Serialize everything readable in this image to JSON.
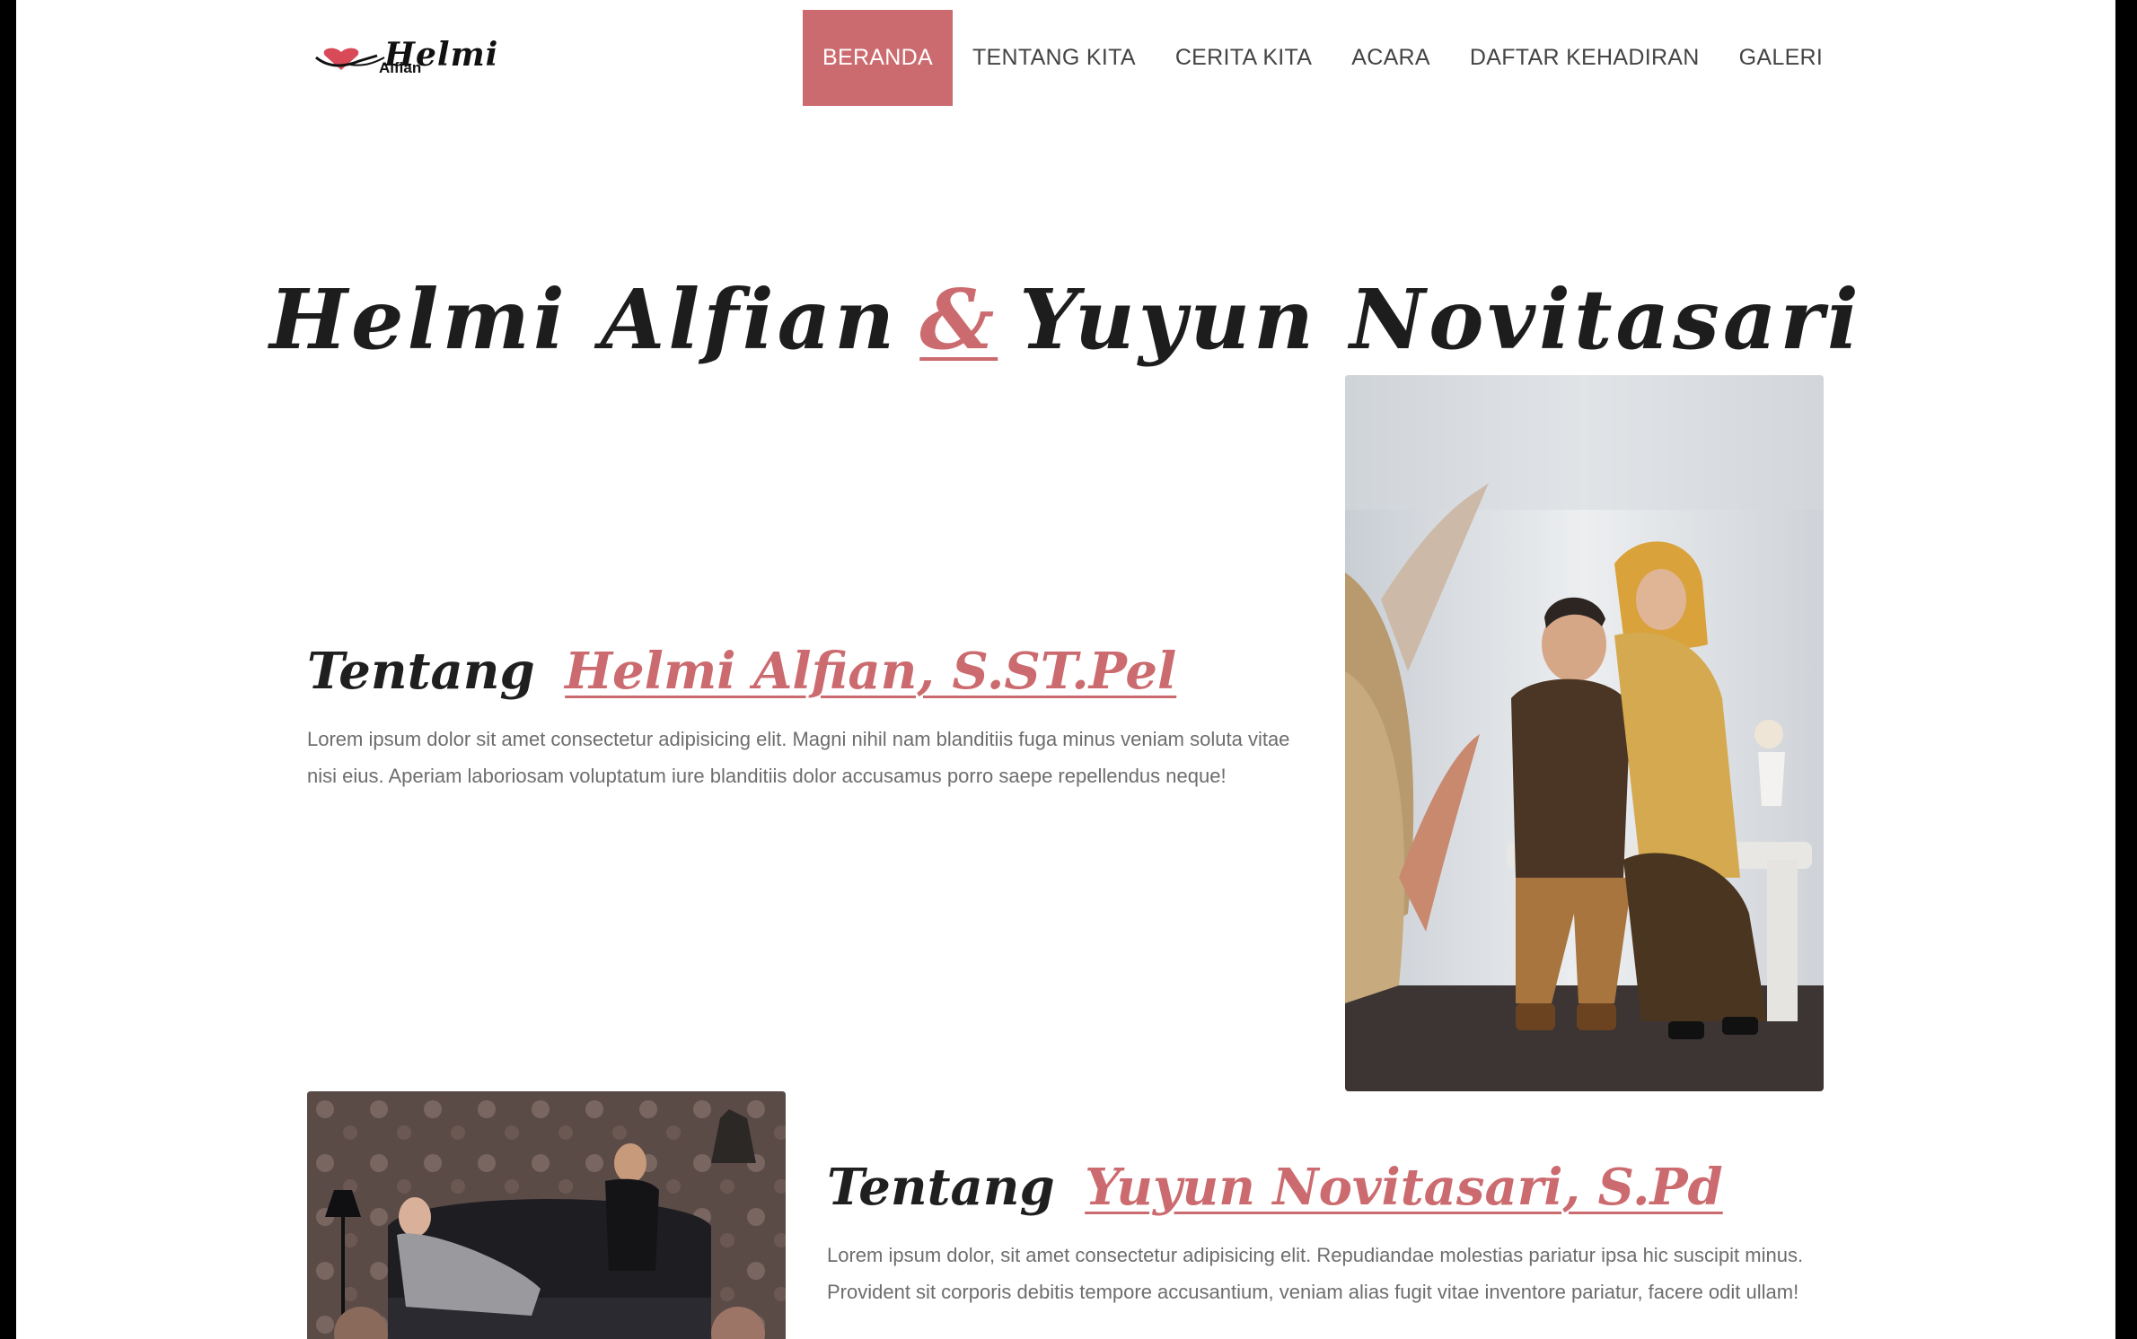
{
  "logo": {
    "word": "Helmi",
    "sub": "Alfian"
  },
  "nav": {
    "items": [
      {
        "label": "BERANDA",
        "active": true
      },
      {
        "label": "TENTANG KITA",
        "active": false
      },
      {
        "label": "CERITA KITA",
        "active": false
      },
      {
        "label": "ACARA",
        "active": false
      },
      {
        "label": "DAFTAR KEHADIRAN",
        "active": false
      },
      {
        "label": "GALERI",
        "active": false
      }
    ]
  },
  "hero": {
    "groom": "Helmi Alfian",
    "amp": "&",
    "bride": "Yuyun Novitasari"
  },
  "about_groom": {
    "prefix": "Tentang",
    "name": "Helmi Alfian, S.ST.Pel",
    "text": "Lorem ipsum dolor sit amet consectetur adipisicing elit. Magni nihil nam blanditiis fuga minus veniam soluta vitae nisi eius. Aperiam laboriosam voluptatum iure blanditiis dolor accusamus porro saepe repellendus neque!"
  },
  "about_bride": {
    "prefix": "Tentang",
    "name": "Yuyun Novitasari, S.Pd",
    "text": "Lorem ipsum dolor, sit amet consectetur adipisicing elit. Repudiandae molestias pariatur ipsa hic suscipit minus. Provident sit corporis debitis tempore accusantium, veniam alias fugit vitae inventore pariatur, facere odit ullam!"
  },
  "colors": {
    "accent": "#cc6b6f",
    "heading": "#1f1f1f",
    "body_text": "#6d6d6d"
  }
}
